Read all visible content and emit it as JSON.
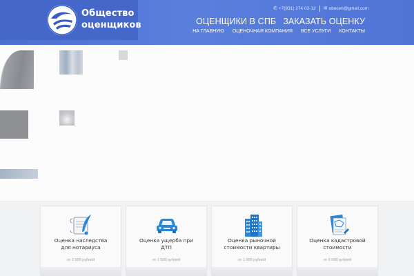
{
  "brand": {
    "name_line1": "Общество",
    "name_line2": "оценщиков"
  },
  "topbar": {
    "phone": "+7(931) 274 02-12",
    "email": "obocen@gmail.com"
  },
  "main_nav": [
    {
      "label": "ОЦЕНЩИКИ В СПБ"
    },
    {
      "label": "ЗАКАЗАТЬ ОЦЕНКУ"
    }
  ],
  "sub_nav": [
    {
      "label": "НА ГЛАВНУЮ"
    },
    {
      "label": "ОЦЕНОЧНАЯ КОМПАНИЯ"
    },
    {
      "label": "ВСЕ УСЛУГИ"
    },
    {
      "label": "КОНТАКТЫ"
    }
  ],
  "services": [
    {
      "title_line1": "Оценка наследства",
      "title_line2": "для нотариуса",
      "price": "от 2 500 рублей",
      "icon": "document-quill-icon"
    },
    {
      "title_line1": "Оценка ущерба при",
      "title_line2": "ДТП",
      "price": "от 1 500 рублей",
      "icon": "car-icon"
    },
    {
      "title_line1": "Оценка рыночной",
      "title_line2": "стоимости квартиры",
      "price": "от 1 000 рублей",
      "icon": "building-icon"
    },
    {
      "title_line1": "Оценка кадастровой",
      "title_line2": "стоимости",
      "price": "от 5 000 рублей",
      "icon": "cadastral-docs-icon"
    }
  ],
  "colors": {
    "header": "#4f74d6",
    "accent_icon": "#2a86d6"
  }
}
